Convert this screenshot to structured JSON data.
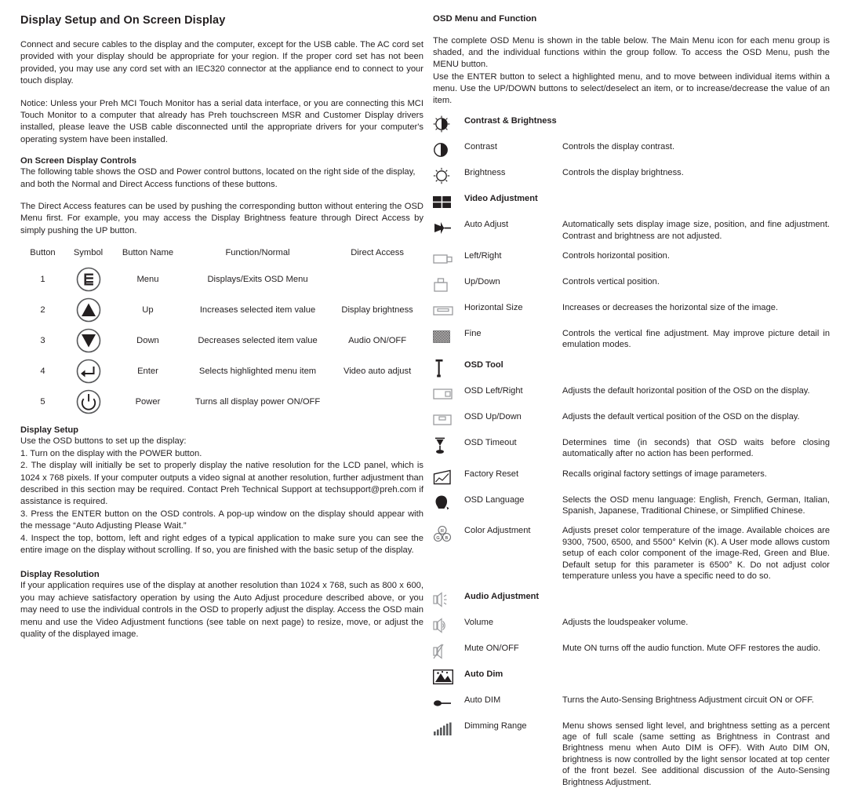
{
  "left": {
    "title": "Display Setup and On Screen Display",
    "intro_1": "Connect and secure cables to the display and the computer, except for the USB cable. The AC cord set provided with your display should be appropriate for your region. If the proper cord set has not been provided, you may use any cord set with an IEC320 connector at the appliance end to connect to your touch display.",
    "intro_2": "Notice: Unless your Preh MCI Touch Monitor has a serial data interface, or you are connecting this MCI Touch Monitor to a computer that already has Preh touchscreen MSR and Customer Display drivers installed, please leave the USB cable disconnected until the appropriate drivers for your computer's operating system have been installed.",
    "osd_controls_heading": "On Screen Display Controls",
    "osd_controls_text": "The following table shows the OSD and Power control buttons, located on the right side of the display, and both the Normal and Direct Access functions of these buttons.",
    "direct_access_text": "The Direct Access features can be used by pushing the corresponding button without entering the OSD Menu first. For example, you may access the Display Brightness feature through Direct Access by simply pushing the UP button.",
    "table": {
      "headers": [
        "Button",
        "Symbol",
        "Button Name",
        "Function/Normal",
        "Direct Access"
      ],
      "rows": [
        {
          "button": "1",
          "symbol": "menu-icon",
          "name": "Menu",
          "function": "Displays/Exits OSD Menu",
          "direct": ""
        },
        {
          "button": "2",
          "symbol": "up-arrow-icon",
          "name": "Up",
          "function": "Increases selected item value",
          "direct": "Display brightness"
        },
        {
          "button": "3",
          "symbol": "down-arrow-icon",
          "name": "Down",
          "function": "Decreases selected item value",
          "direct": "Audio ON/OFF"
        },
        {
          "button": "4",
          "symbol": "enter-icon",
          "name": "Enter",
          "function": "Selects highlighted menu item",
          "direct": "Video auto adjust"
        },
        {
          "button": "5",
          "symbol": "power-icon",
          "name": "Power",
          "function": "Turns all display power ON/OFF",
          "direct": ""
        }
      ]
    },
    "display_setup_heading": "Display Setup",
    "display_setup_lead": "Use the OSD buttons to set up the display:",
    "display_setup_step1": "1. Turn on the display with the POWER button.",
    "display_setup_step2": "2. The display will initially be set to properly display the native resolution for the LCD panel, which is 1024 x 768 pixels. If your computer outputs a video signal at another resolution, further adjustment than described in this section may be required. Contact Preh Technical Support at techsupport@preh.com if assistance is required.",
    "display_setup_step3": "3. Press the ENTER button on the OSD controls. A pop-up window on the display should appear with the message “Auto Adjusting Please Wait.”",
    "display_setup_step4": "4. Inspect the top, bottom, left and right edges of a typical application to make sure you can see the entire image on the display without scrolling. If so, you are finished with the basic setup of the display.",
    "display_resolution_heading": "Display Resolution",
    "display_resolution_text": "If your application requires use of the display at another resolution than 1024 x 768, such as 800 x 600, you may achieve satisfactory operation by using the Auto Adjust procedure described above, or you may need to use the individual controls in the OSD to properly adjust the display. Access the OSD main menu and use the Video Adjustment functions (see table on next page) to resize, move, or adjust the quality of the displayed image."
  },
  "right": {
    "title": "OSD Menu and Function",
    "intro_1": "The complete OSD Menu is shown in the table below. The Main Menu icon for each menu group is shaded, and the individual functions within the group follow. To access the OSD Menu, push the MENU button.",
    "intro_2": "Use the ENTER button to select a highlighted menu, and to move between individual items within a menu. Use the UP/DOWN buttons to select/deselect an item, or to increase/decrease the value of an item.",
    "rows": [
      {
        "icon": "contrast-brightness-icon",
        "label": "Contrast & Brightness",
        "desc": "",
        "group": true
      },
      {
        "icon": "contrast-icon",
        "label": "Contrast",
        "desc": "Controls the display contrast.",
        "group": false
      },
      {
        "icon": "brightness-sun-icon",
        "label": "Brightness",
        "desc": "Controls the display brightness.",
        "group": false
      },
      {
        "icon": "video-adjustment-icon",
        "label": "Video Adjustment",
        "desc": "",
        "group": true
      },
      {
        "icon": "auto-adjust-arrow-icon",
        "label": "Auto Adjust",
        "desc": "Automatically sets display image size, position, and fine adjustment. Contrast and brightness are not adjusted.",
        "group": false
      },
      {
        "icon": "left-right-icon",
        "label": "Left/Right",
        "desc": "Controls horizontal position.",
        "group": false
      },
      {
        "icon": "up-down-icon",
        "label": "Up/Down",
        "desc": "Controls vertical position.",
        "group": false
      },
      {
        "icon": "horizontal-size-icon",
        "label": "Horizontal Size",
        "desc": "Increases or decreases the horizontal size of the image.",
        "group": false
      },
      {
        "icon": "fine-icon",
        "label": "Fine",
        "desc": "Controls the vertical fine adjustment. May improve picture detail in emulation modes.",
        "group": false
      },
      {
        "icon": "osd-tool-icon",
        "label": "OSD Tool",
        "desc": "",
        "group": true
      },
      {
        "icon": "osd-left-right-icon",
        "label": "OSD Left/Right",
        "desc": "Adjusts the default horizontal position of the OSD on the display.",
        "group": false
      },
      {
        "icon": "osd-up-down-icon",
        "label": "OSD Up/Down",
        "desc": "Adjusts the default vertical position of the OSD on the display.",
        "group": false
      },
      {
        "icon": "osd-timeout-icon",
        "label": "OSD Timeout",
        "desc": "Determines time (in seconds) that OSD waits before closing automatically after no action has been performed.",
        "group": false
      },
      {
        "icon": "factory-reset-icon",
        "label": "Factory Reset",
        "desc": "Recalls original factory settings of image parameters.",
        "group": false
      },
      {
        "icon": "osd-language-icon",
        "label": "OSD Language",
        "desc": "Selects the OSD menu language: English, French, German, Italian, Spanish, Japanese, Traditional Chinese, or Simplified Chinese.",
        "group": false
      },
      {
        "icon": "color-adjustment-icon",
        "label": "Color Adjustment",
        "desc": "Adjusts preset color temperature of the image. Available choices are 9300, 7500, 6500, and 5500° Kelvin (K). A User mode allows custom setup of each color component of the image-Red, Green and Blue. Default setup for this parameter is 6500° K. Do not adjust color temperature unless you have a specific need to do so.",
        "group": false
      },
      {
        "icon": "audio-adjustment-icon",
        "label": "Audio Adjustment",
        "desc": "",
        "group": true
      },
      {
        "icon": "volume-icon",
        "label": "Volume",
        "desc": "Adjusts the loudspeaker volume.",
        "group": false
      },
      {
        "icon": "mute-icon",
        "label": "Mute ON/OFF",
        "desc": "Mute ON turns off the audio function. Mute OFF restores the audio.",
        "group": false
      },
      {
        "icon": "auto-dim-icon",
        "label": "Auto Dim",
        "desc": "",
        "group": true
      },
      {
        "icon": "auto-dim-switch-icon",
        "label": "Auto DIM",
        "desc": "Turns the Auto-Sensing Brightness Adjustment circuit ON or OFF.",
        "group": false
      },
      {
        "icon": "dimming-range-icon",
        "label": "Dimming Range",
        "desc": "Menu shows sensed light level, and brightness setting as a percent age of full scale (same setting as Brightness in Contrast and Brightness menu when Auto DIM is OFF). With Auto DIM ON, brightness is now controlled by the light sensor located at top center of the front bezel. See additional discussion of the Auto-Sensing Brightness Adjustment.",
        "group": false
      }
    ]
  }
}
